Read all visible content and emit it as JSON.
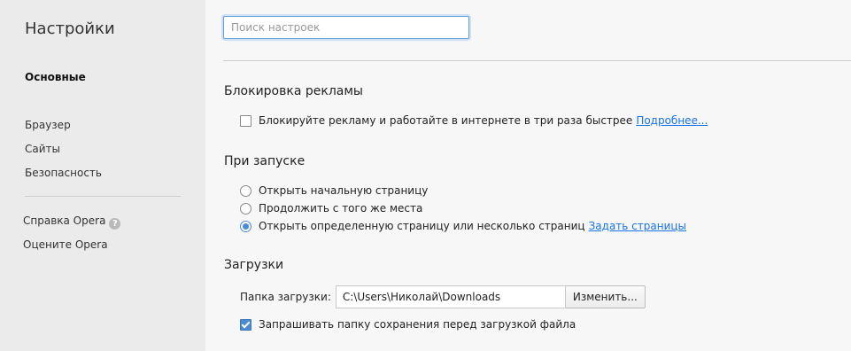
{
  "sidebar": {
    "title": "Настройки",
    "items": [
      {
        "label": "Основные"
      },
      {
        "label": "Браузер"
      },
      {
        "label": "Сайты"
      },
      {
        "label": "Безопасность"
      }
    ],
    "links": [
      {
        "label": "Справка Opera",
        "icon": "?"
      },
      {
        "label": "Оцените Opera"
      }
    ]
  },
  "search": {
    "placeholder": "Поиск настроек",
    "value": ""
  },
  "adblock": {
    "title": "Блокировка рекламы",
    "checkbox_label": "Блокируйте рекламу и работайте в интернете в три раза быстрее",
    "checked": false,
    "link": "Подробнее..."
  },
  "startup": {
    "title": "При запуске",
    "options": [
      {
        "label": "Открыть начальную страницу",
        "selected": false
      },
      {
        "label": "Продолжить с того же места",
        "selected": false
      },
      {
        "label": "Открыть определенную страницу или несколько страниц",
        "selected": true
      }
    ],
    "link": "Задать страницы"
  },
  "downloads": {
    "title": "Загрузки",
    "folder_label": "Папка загрузки:",
    "folder_value": "C:\\Users\\Николай\\Downloads",
    "change_button": "Изменить...",
    "ask_label": "Запрашивать папку сохранения перед загрузкой файла",
    "ask_checked": true
  },
  "colors": {
    "accent": "#4a8bd2",
    "link": "#1a73e8",
    "sidebar_bg": "#ebebeb",
    "main_bg": "#f7f7f7"
  }
}
